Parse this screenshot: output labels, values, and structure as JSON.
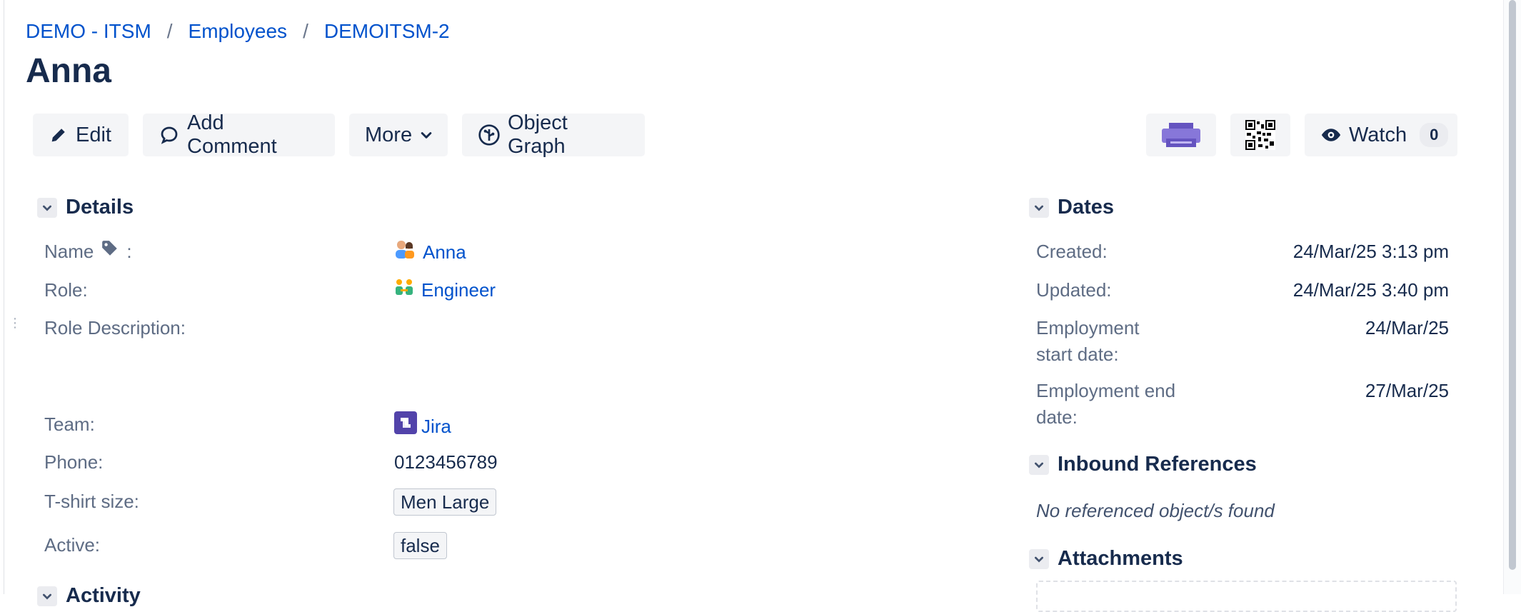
{
  "breadcrumb": {
    "project": "DEMO - ITSM",
    "object_type": "Employees",
    "key": "DEMOITSM-2",
    "separator": "/"
  },
  "title": "Anna",
  "toolbar": {
    "edit": "Edit",
    "add_comment": "Add Comment",
    "more": "More",
    "object_graph": "Object Graph",
    "watch": "Watch",
    "watch_count": "0",
    "accent": "#6554c0"
  },
  "details": {
    "heading": "Details",
    "name_label": "Name",
    "name_colon": ":",
    "name_value": "Anna",
    "role_label": "Role:",
    "role_value": "Engineer",
    "role_description_label": "Role Description:",
    "team_label": "Team:",
    "team_value": "Jira",
    "phone_label": "Phone:",
    "phone_value": "0123456789",
    "tshirt_label": "T-shirt size:",
    "tshirt_value": "Men Large",
    "active_label": "Active:",
    "active_value": "false"
  },
  "dates": {
    "heading": "Dates",
    "created_label": "Created:",
    "created_value": "24/Mar/25 3:13 pm",
    "updated_label": "Updated:",
    "updated_value": "24/Mar/25 3:40 pm",
    "start_label_1": "Employment",
    "start_label_2": "start date:",
    "start_value": "24/Mar/25",
    "end_label_1": "Employment end",
    "end_label_2": "date:",
    "end_value": "27/Mar/25"
  },
  "inbound": {
    "heading": "Inbound References",
    "empty_text": "No referenced object/s found"
  },
  "attachments": {
    "heading": "Attachments"
  },
  "activity": {
    "heading": "Activity"
  },
  "colors": {
    "link": "#0052cc",
    "text": "#172b4d",
    "muted": "#5e6c84",
    "button_bg": "#f4f5f7"
  }
}
